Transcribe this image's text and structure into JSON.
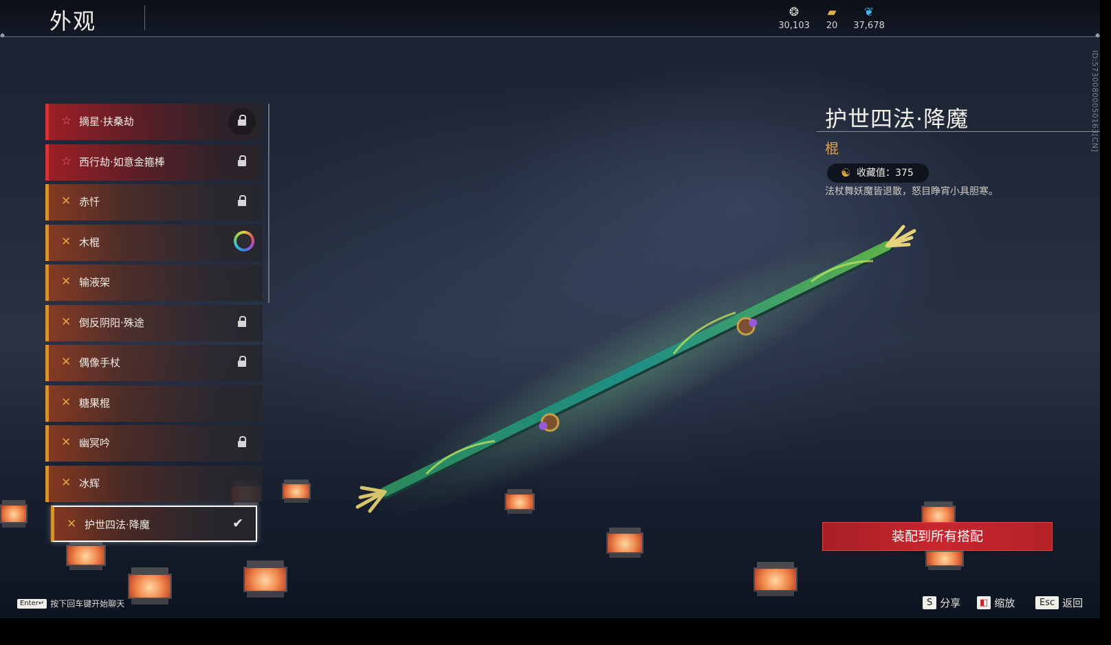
{
  "header": {
    "title": "外观",
    "currencies": [
      {
        "icon": "spirit-coin-icon",
        "glyph": "❂",
        "color": "#d8d6d0",
        "value": "30,103"
      },
      {
        "icon": "ticket-icon",
        "glyph": "▰",
        "color": "#e3b34a",
        "value": "20"
      },
      {
        "icon": "feather-icon",
        "glyph": "❦",
        "color": "#4cb8e8",
        "value": "37,678"
      }
    ]
  },
  "list": {
    "items": [
      {
        "label": "摘星·扶桑劫",
        "rarity": "red",
        "state": "locked-disc"
      },
      {
        "label": "西行劫·如意金箍棒",
        "rarity": "red",
        "state": "locked"
      },
      {
        "label": "赤忏",
        "rarity": "gold",
        "state": "locked"
      },
      {
        "label": "木棍",
        "rarity": "gold",
        "state": "ring"
      },
      {
        "label": "输液架",
        "rarity": "gold",
        "state": "none"
      },
      {
        "label": "倒反阴阳·殊途",
        "rarity": "gold",
        "state": "locked"
      },
      {
        "label": "偶像手杖",
        "rarity": "gold",
        "state": "locked"
      },
      {
        "label": "糖果棍",
        "rarity": "gold",
        "state": "none"
      },
      {
        "label": "幽冥吟",
        "rarity": "gold",
        "state": "locked"
      },
      {
        "label": "冰辉",
        "rarity": "gold",
        "state": "none"
      },
      {
        "label": "护世四法·降魔",
        "rarity": "gold",
        "state": "selected"
      }
    ],
    "star_glyph": "☆",
    "gold_glyph": "✕",
    "check_glyph": "✔"
  },
  "detail": {
    "title": "护世四法·降魔",
    "type": "棍",
    "collect_label": "收藏值：375",
    "description": "法杖舞妖魔皆退散，怒目睁宵小具胆寒。",
    "side_id": "ID:57300800050163[CN]"
  },
  "equip_button": "装配到所有搭配",
  "footer": {
    "chat_key": "Enter↵",
    "chat_hint": "按下回车键开始聊天",
    "share_key": "S",
    "share_label": "分享",
    "zoom_label": "缩放",
    "back_key": "Esc",
    "back_label": "返回"
  },
  "colors": {
    "gold_accent": "#d9922e",
    "red_accent": "#d8323a",
    "equip_red": "#c8262d",
    "type_gold": "#e0a54d"
  }
}
